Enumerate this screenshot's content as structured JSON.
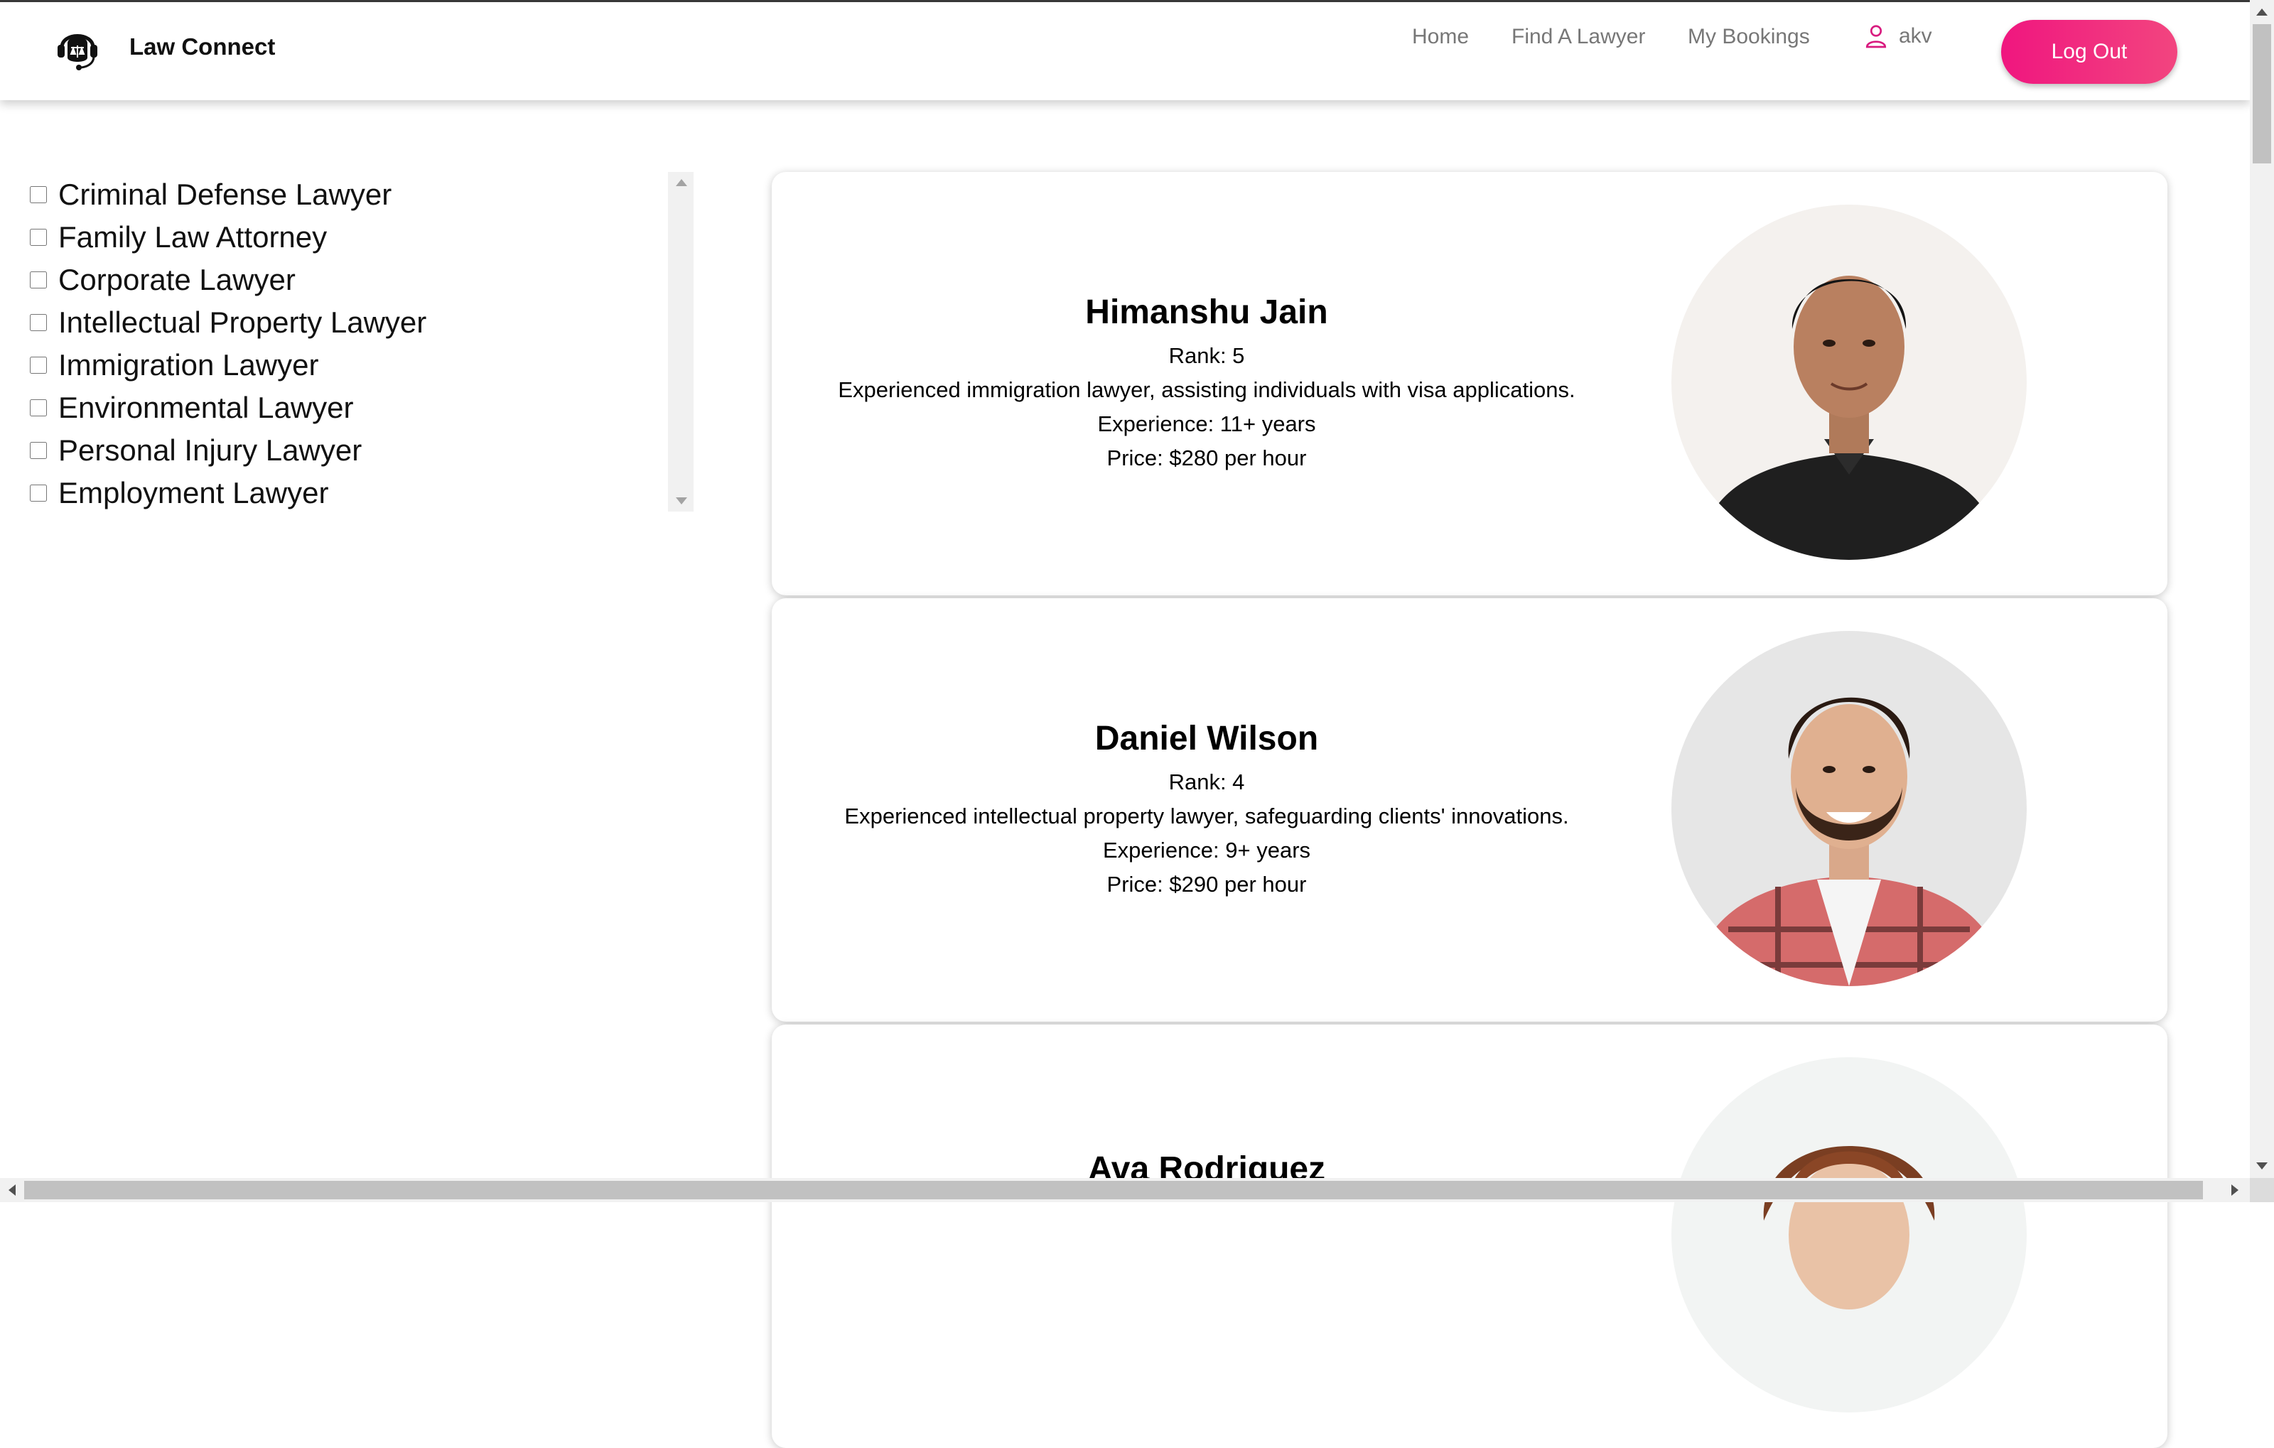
{
  "app": {
    "brand_name": "Law Connect",
    "logo_icon": "lawyer-headset-icon"
  },
  "nav": {
    "links": [
      "Home",
      "Find A Lawyer",
      "My Bookings"
    ],
    "user_name": "akv",
    "logout_label": "Log Out"
  },
  "colors": {
    "accent": "#f0167f",
    "nav_text": "#777777"
  },
  "filters": {
    "categories": [
      "Criminal Defense Lawyer",
      "Family Law Attorney",
      "Corporate Lawyer",
      "Intellectual Property Lawyer",
      "Immigration Lawyer",
      "Environmental Lawyer",
      "Personal Injury Lawyer",
      "Employment Lawyer"
    ]
  },
  "lawyers": [
    {
      "name": "Himanshu Jain",
      "rank": "Rank: 5",
      "description": "Experienced immigration lawyer, assisting individuals with visa applications.",
      "experience": "Experience: 11+ years",
      "price": "Price: $280 per hour"
    },
    {
      "name": "Daniel Wilson",
      "rank": "Rank: 4",
      "description": "Experienced intellectual property lawyer, safeguarding clients' innovations.",
      "experience": "Experience: 9+ years",
      "price": "Price: $290 per hour"
    },
    {
      "name": "Ava Rodriguez"
    }
  ]
}
